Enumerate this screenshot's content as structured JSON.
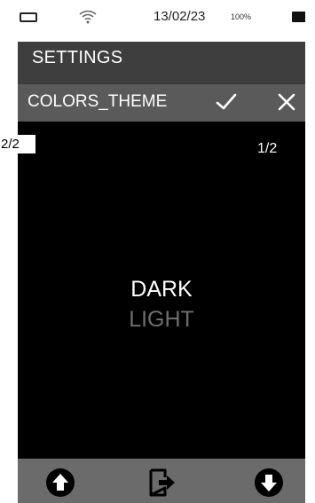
{
  "status_bar": {
    "date": "13/02/23",
    "battery_percent": "100%"
  },
  "header": {
    "title": "SETTINGS"
  },
  "subheader": {
    "label": "COLORS_THEME",
    "confirm_icon": "check-icon",
    "cancel_icon": "close-icon"
  },
  "content": {
    "page_indicator": "1/2",
    "options": [
      "DARK",
      "LIGHT"
    ],
    "selected_option": "DARK"
  },
  "edge_badge": "2/2",
  "bottom_bar": {
    "icons": [
      "arrow-up-circle-icon",
      "exit-icon",
      "arrow-down-circle-icon"
    ]
  },
  "colors": {
    "background": "#000000",
    "header": "#3e3e3e",
    "subheader": "#5a5a5a",
    "bottom_bar": "#6b6b6b",
    "selected_text": "#ffffff",
    "unselected_text": "#6e6e6e"
  }
}
